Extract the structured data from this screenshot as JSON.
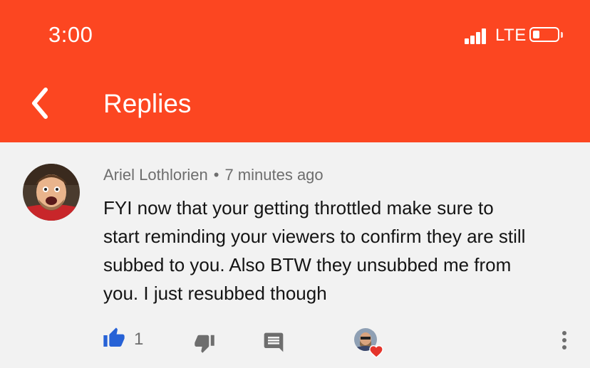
{
  "status_bar": {
    "time": "3:00",
    "network": "LTE",
    "signal_icon": "cellular-signal-icon",
    "battery_icon": "battery-low-icon",
    "battery_level": 0.2
  },
  "header": {
    "title": "Replies",
    "back_icon": "chevron-left-icon",
    "background_color": "#fc4621"
  },
  "comment": {
    "author": "Ariel Lothlorien",
    "separator": "•",
    "timestamp": "7 minutes ago",
    "text_lines": [
      "FYI now that your getting throttled make sure to",
      "start reminding your viewers to confirm they are still",
      "subbed to you. Also BTW they unsubbed me from",
      "you. I just resubbed though"
    ]
  },
  "actions": {
    "like_icon": "thumbs-up-icon",
    "like_count": "1",
    "like_color": "#2762d6",
    "dislike_icon": "thumbs-down-icon",
    "reply_icon": "comment-icon",
    "creator_heart_icon": "heart-icon",
    "heart_color": "#e5342b",
    "more_icon": "more-vertical-icon"
  }
}
